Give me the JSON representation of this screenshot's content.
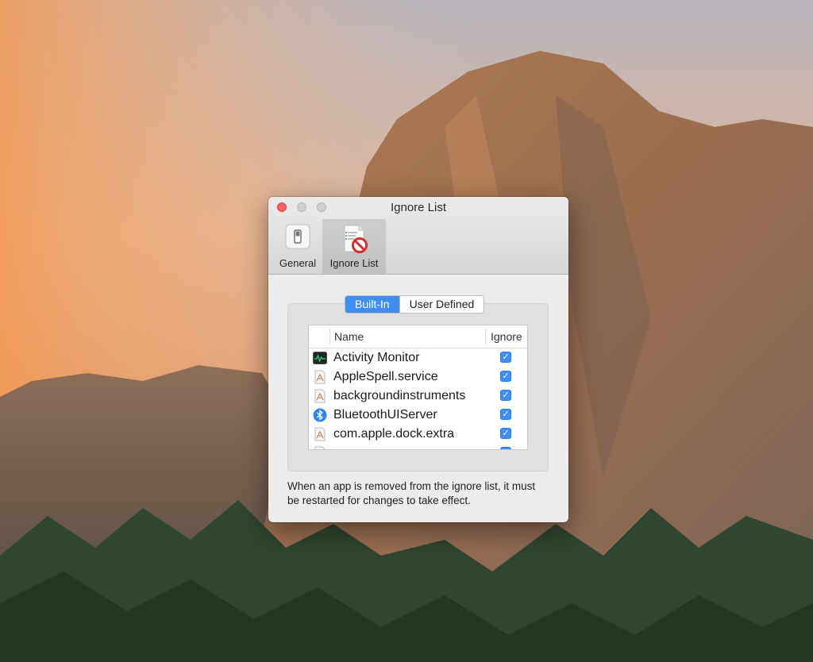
{
  "window": {
    "title": "Ignore List"
  },
  "toolbar": {
    "items": [
      {
        "label": "General",
        "icon": "switch-icon",
        "selected": false
      },
      {
        "label": "Ignore List",
        "icon": "ignore-list-icon",
        "selected": true
      }
    ]
  },
  "segmented": {
    "options": [
      "Built-In",
      "User Defined"
    ],
    "selected": "Built-In"
  },
  "table": {
    "columns": [
      "Name",
      "Ignore"
    ],
    "rows": [
      {
        "name": "Activity Monitor",
        "icon": "activity-monitor-icon",
        "ignore": true
      },
      {
        "name": "AppleSpell.service",
        "icon": "generic-app-icon",
        "ignore": true
      },
      {
        "name": "backgroundinstruments",
        "icon": "generic-app-icon",
        "ignore": true
      },
      {
        "name": "BluetoothUIServer",
        "icon": "bluetooth-icon",
        "ignore": true
      },
      {
        "name": "com.apple.dock.extra",
        "icon": "generic-app-icon",
        "ignore": true
      }
    ]
  },
  "note": "When an app is removed from the ignore list, it must be restarted for changes to take effect.",
  "colors": {
    "accent": "#3f8ef7",
    "close_button": "#fc605c"
  }
}
